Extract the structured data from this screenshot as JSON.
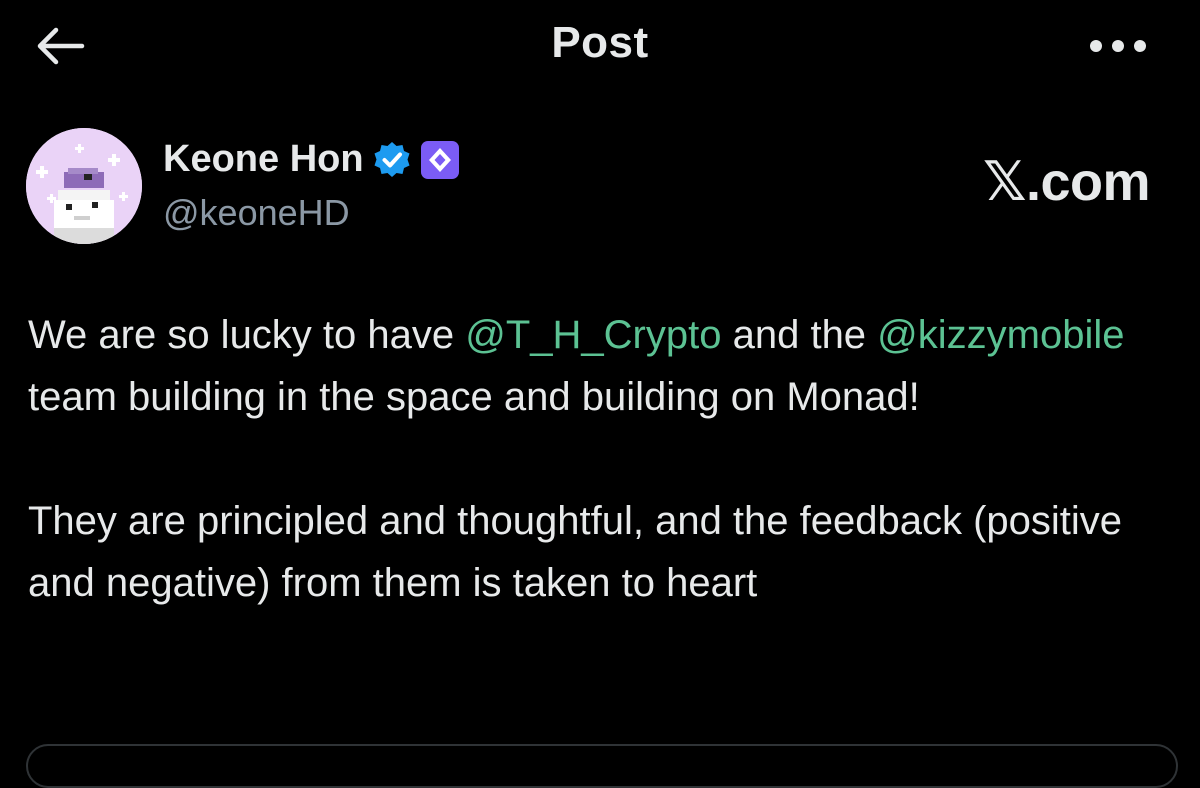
{
  "header": {
    "title": "Post",
    "back_icon": "arrow-left-icon",
    "more_icon": "more-horizontal-icon"
  },
  "author": {
    "display_name": "Keone Hon",
    "handle": "@keoneHD",
    "verified_icon": "verified-badge-icon",
    "affiliate_icon": "affiliate-badge-icon"
  },
  "watermark": "𝕏.com",
  "post": {
    "paragraph1": {
      "text1": "We are so lucky to have ",
      "mention1": "@T_H_Crypto",
      "text2": " and the ",
      "mention2": "@kizzymobile",
      "text3": " team building in the space and building on Monad!"
    },
    "paragraph2": "They are principled and thoughtful, and the feedback (positive and negative) from them is taken to heart"
  },
  "colors": {
    "background": "#000000",
    "text": "#e7e9ea",
    "secondary_text": "#8b98a5",
    "mention": "#5cc293",
    "verified_blue": "#1d9bf0",
    "affiliate_purple": "#7b5cf5"
  }
}
